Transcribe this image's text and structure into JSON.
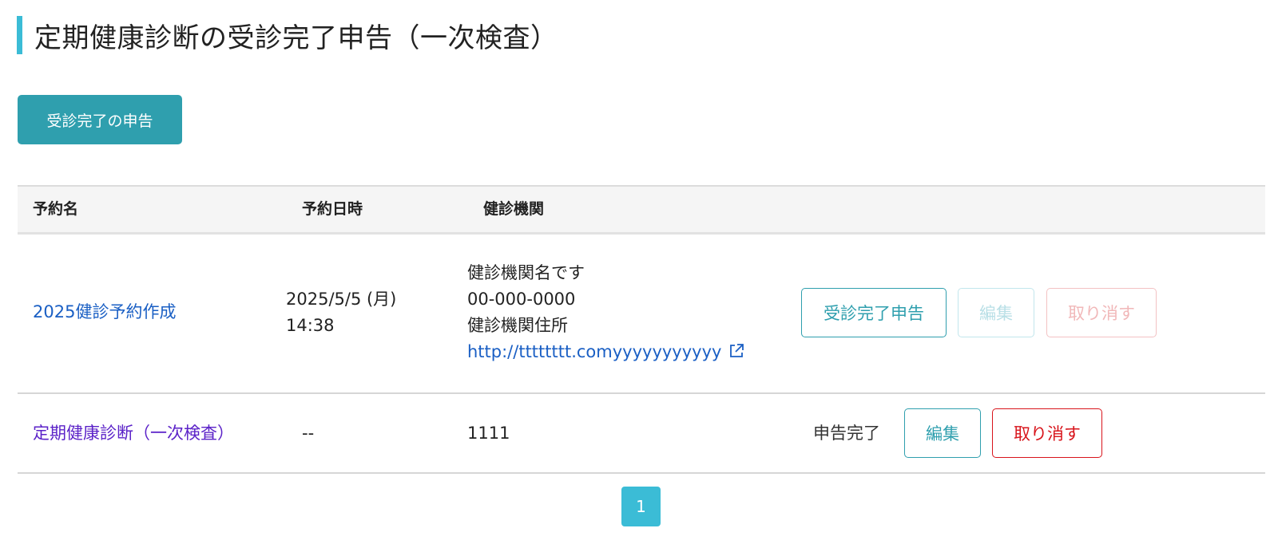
{
  "page": {
    "title": "定期健康診断の受診完了申告（一次検査）",
    "accent_color": "#3bbcd6"
  },
  "actions": {
    "report_button_label": "受診完了の申告"
  },
  "table": {
    "headers": {
      "name": "予約名",
      "datetime": "予約日時",
      "institution": "健診機関"
    },
    "rows": [
      {
        "name": "2025健診予約作成",
        "date": "2025/5/5 (月)",
        "time": "14:38",
        "institution_name": "健診機関名です",
        "institution_phone": "00-000-0000",
        "institution_address": "健診機関住所",
        "institution_url": "http://tttttttt.comyyyyyyyyyyy",
        "report_button": "受診完了申告",
        "edit_button": "編集",
        "cancel_button": "取り消す"
      },
      {
        "name": "定期健康診断（一次検査）",
        "datetime": "--",
        "institution": "1111",
        "status": "申告完了",
        "edit_button": "編集",
        "cancel_button": "取り消す"
      }
    ]
  },
  "pagination": {
    "current_page": "1"
  },
  "colors": {
    "primary": "#2f9fae",
    "danger": "#d8141b",
    "link": "#1a5fc4",
    "link_visited": "#5b22c8"
  },
  "icons": {
    "external_link": "external-link-icon"
  }
}
